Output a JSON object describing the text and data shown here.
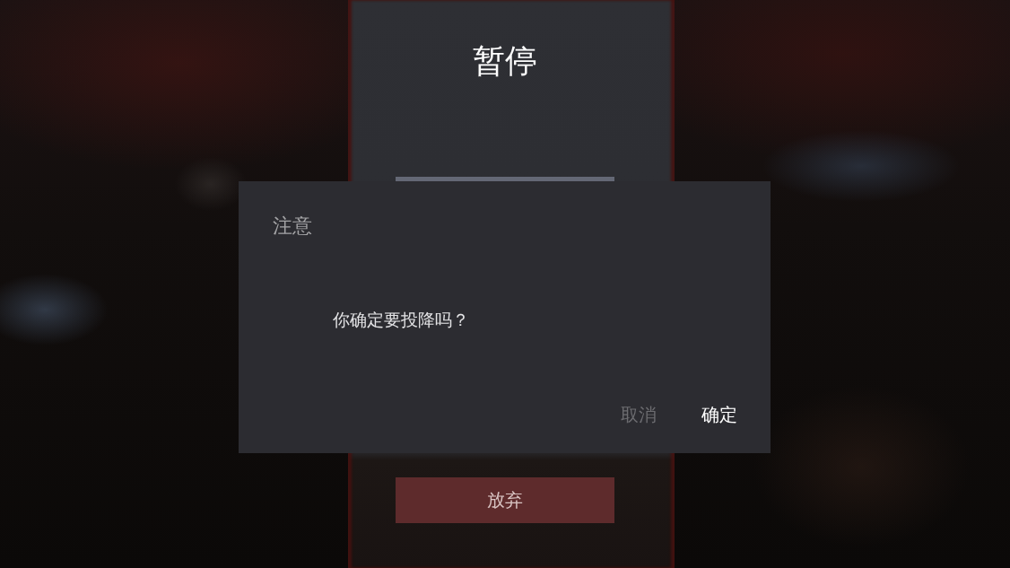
{
  "pause_menu": {
    "title": "暂停",
    "buttons": [
      {
        "label": "放弃",
        "kind": "danger"
      }
    ]
  },
  "dialog": {
    "title": "注意",
    "message": "你确定要投降吗？",
    "buttons": [
      {
        "label": "取消",
        "kind": "secondary"
      },
      {
        "label": "确定",
        "kind": "primary"
      }
    ]
  }
}
